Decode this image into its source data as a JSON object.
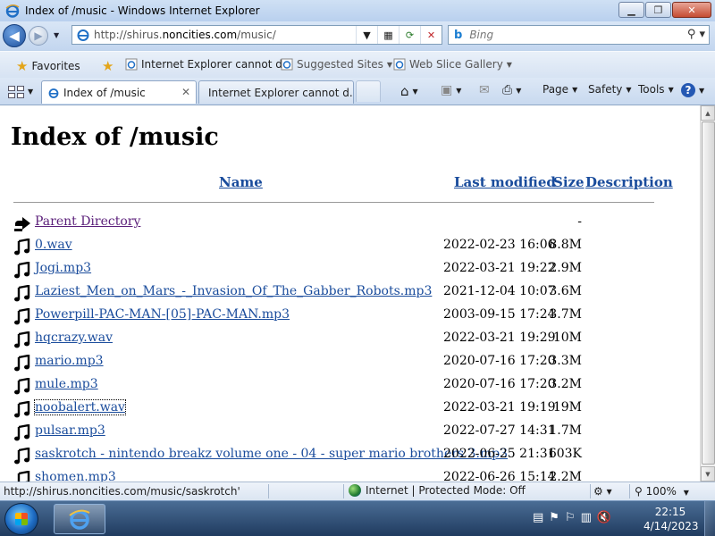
{
  "window": {
    "title": "Index of /music - Windows Internet Explorer",
    "minimize_glyph": "▁",
    "maximize_glyph": "❐",
    "close_glyph": "✕"
  },
  "address_bar": {
    "url_prefix": "http://shirus.",
    "url_domain": "noncities.com",
    "url_suffix": "/music/",
    "search_placeholder": "Bing",
    "search_logo": "b"
  },
  "favorites_bar": {
    "favorites_label": "Favorites",
    "items": [
      {
        "label": "Internet Explorer cannot d..."
      },
      {
        "label": "Suggested Sites"
      },
      {
        "label": "Web Slice Gallery"
      }
    ]
  },
  "tabs": [
    {
      "label": "Index of /music",
      "active": true
    },
    {
      "label": "Internet Explorer cannot d...",
      "active": false
    }
  ],
  "command_bar": {
    "page": "Page",
    "safety": "Safety",
    "tools": "Tools",
    "help": "?"
  },
  "listing": {
    "title": "Index of /music",
    "columns": {
      "name": "Name",
      "last_modified": "Last modified",
      "size": "Size",
      "description": "Description"
    },
    "rows": [
      {
        "name": "Parent Directory",
        "date": "",
        "size": "-",
        "icon": "parent-directory-icon",
        "visited": true
      },
      {
        "name": "0.wav",
        "date": "2022-02-23 16:06",
        "size": "8.8M",
        "icon": "music-note-icon"
      },
      {
        "name": "Jogi.mp3",
        "date": "2022-03-21 19:22",
        "size": "2.9M",
        "icon": "music-note-icon"
      },
      {
        "name": "Laziest_Men_on_Mars_-_Invasion_Of_The_Gabber_Robots.mp3",
        "date": "2021-12-04 10:07",
        "size": "3.6M",
        "icon": "music-note-icon"
      },
      {
        "name": "Powerpill-PAC-MAN-[05]-PAC-MAN.mp3",
        "date": "2003-09-15 17:24",
        "size": "3.7M",
        "icon": "music-note-icon"
      },
      {
        "name": "hqcrazy.wav",
        "date": "2022-03-21 19:29",
        "size": "10M",
        "icon": "music-note-icon"
      },
      {
        "name": "mario.mp3",
        "date": "2020-07-16 17:20",
        "size": "3.3M",
        "icon": "music-note-icon"
      },
      {
        "name": "mule.mp3",
        "date": "2020-07-16 17:20",
        "size": "3.2M",
        "icon": "music-note-icon"
      },
      {
        "name": "noobalert.wav",
        "date": "2022-03-21 19:19",
        "size": "19M",
        "icon": "music-note-icon",
        "focused": true
      },
      {
        "name": "pulsar.mp3",
        "date": "2022-07-27 14:31",
        "size": "1.7M",
        "icon": "music-note-icon"
      },
      {
        "name": "saskrotch - nintendo breakz volume one - 04 - super mario brothers 3.mp3",
        "date": "2022-06-25 21:31",
        "size": "603K",
        "icon": "music-note-icon"
      },
      {
        "name": "shomen.mp3",
        "date": "2022-06-26 15:14",
        "size": "2.2M",
        "icon": "music-note-icon"
      }
    ]
  },
  "status_bar": {
    "url": "http://shirus.noncities.com/music/saskrotch'",
    "zone": "Internet | Protected Mode: Off",
    "zoom": "100%"
  },
  "taskbar": {
    "time": "22:15",
    "date": "4/14/2023"
  }
}
